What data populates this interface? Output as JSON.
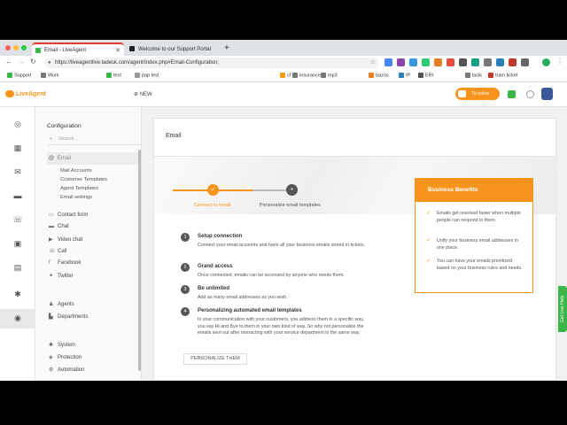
{
  "browser": {
    "tabs": [
      {
        "title": "Email - LiveAgent",
        "active": true
      },
      {
        "title": "Welcome to our Support Portal",
        "active": false
      }
    ],
    "new_tab": "+",
    "url": "https://liveagentlive.ladesk.com/agent/index.php#Email-Configuration;",
    "bookmarks": [
      "Support",
      "Work",
      "test",
      "pap test",
      "cf",
      "insurance",
      "mp3",
      "bazos",
      "IP",
      "ERI",
      "lasik",
      "tram ticket"
    ]
  },
  "app": {
    "logo": "LiveAgent",
    "new_label": "NEW",
    "to_solve_label": "To solve"
  },
  "subnav": {
    "title": "Configuration",
    "search_placeholder": "Search ...",
    "items": [
      {
        "label": "Email",
        "icon": "at-icon"
      },
      {
        "label": "Contact form",
        "icon": "form-icon"
      },
      {
        "label": "Chat",
        "icon": "chat-icon"
      },
      {
        "label": "Video chat",
        "icon": "video-icon"
      },
      {
        "label": "Call",
        "icon": "phone-icon"
      },
      {
        "label": "Facebook",
        "icon": "facebook-icon"
      },
      {
        "label": "Twitter",
        "icon": "twitter-icon"
      },
      {
        "label": "Agents",
        "icon": "agents-icon"
      },
      {
        "label": "Departments",
        "icon": "departments-icon"
      },
      {
        "label": "System",
        "icon": "gear-icon"
      },
      {
        "label": "Protection",
        "icon": "shield-icon"
      },
      {
        "label": "Automation",
        "icon": "automation-icon"
      }
    ],
    "email_sub": [
      "Mail Accounts",
      "Customer Templates",
      "Agent Templates",
      "Email settings"
    ]
  },
  "main": {
    "title": "Email",
    "steps": [
      {
        "label": "Connect to email",
        "state": "done",
        "symbol": "✓"
      },
      {
        "label": "Personalize email templates",
        "state": "pending",
        "symbol": "•"
      }
    ],
    "guide": [
      {
        "num": "1",
        "title": "Setup connection",
        "desc": "Connect your email accounts and have all your business emails stored in tickets."
      },
      {
        "num": "2",
        "title": "Grand access",
        "desc": "Once connected, emails can be accessed by anyone who needs them."
      },
      {
        "num": "3",
        "title": "Be unlimited",
        "desc": "Add as many email addresses as you wish."
      },
      {
        "num": "4",
        "title": "Personalizing automated email templates",
        "desc": "In your communication with your customers, you address them in a specific way, you say Hi and Bye to them in your own kind of way. So why not personalize the emails sent out after interacting with your service department in the same way."
      }
    ],
    "personalize_button": "PERSONALIZE THEM",
    "benefits": {
      "title": "Business Benefits",
      "items": [
        "Emails get resolved faster when multiple people can respond to them.",
        "Unify your business email addresses in one place.",
        "You can have your emails prioritized based on your business rules and needs."
      ]
    }
  },
  "live_help": "Get Live Help",
  "colors": {
    "accent": "#f7941d",
    "live_help": "#3cb54a"
  }
}
